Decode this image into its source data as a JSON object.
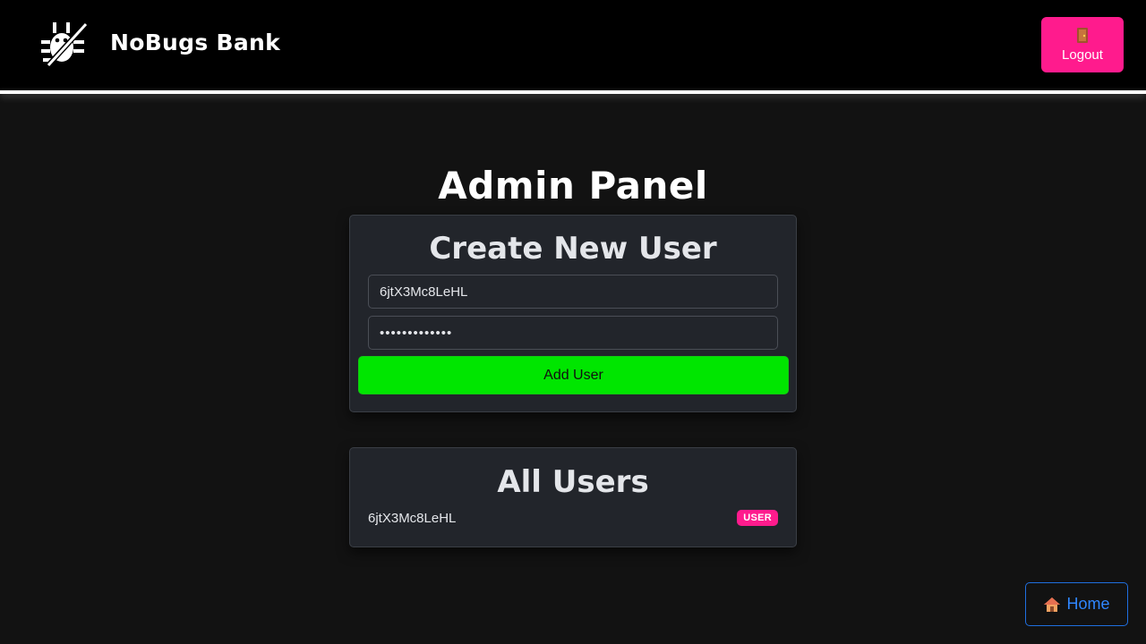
{
  "header": {
    "brand": "NoBugs Bank",
    "logo_icon": "bug-slash-icon",
    "logout_label": "Logout",
    "logout_icon": "door-icon"
  },
  "main": {
    "title": "Admin Panel",
    "create_card": {
      "title": "Create New User",
      "username_value": "6jtX3Mc8LeHL",
      "password_value": "•••••••••••••",
      "add_button_label": "Add User"
    },
    "users_card": {
      "title": "All Users",
      "users": [
        {
          "username": "6jtX3Mc8LeHL",
          "role": "USER"
        }
      ]
    }
  },
  "footer": {
    "home_label": "Home",
    "home_icon": "house-icon"
  },
  "colors": {
    "accent_pink": "#ff1b8d",
    "add_green": "#00e600",
    "home_blue": "#2f86ff",
    "card_bg": "#22252b",
    "page_bg": "#121212"
  }
}
